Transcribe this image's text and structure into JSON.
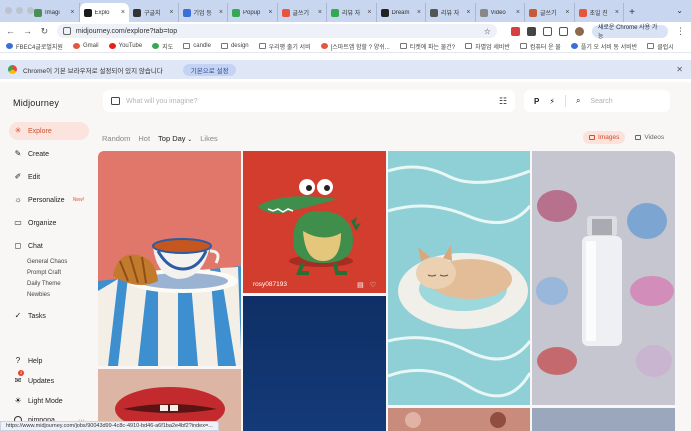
{
  "browser": {
    "tabs": [
      {
        "title": "Imagi",
        "color": "#4a8f5a",
        "active": false
      },
      {
        "title": "Explo",
        "color": "#1b1b1b",
        "active": true
      },
      {
        "title": "구글지",
        "color": "#333333",
        "active": false
      },
      {
        "title": "기업 등",
        "color": "#3a6fd8",
        "active": false
      },
      {
        "title": "Popup",
        "color": "#34a853",
        "active": false
      },
      {
        "title": "글쓰기",
        "color": "#e8553d",
        "active": false
      },
      {
        "title": "리뷰 자",
        "color": "#34a853",
        "active": false
      },
      {
        "title": "Dream",
        "color": "#222222",
        "active": false
      },
      {
        "title": "리뷰 자",
        "color": "#555555",
        "active": false
      },
      {
        "title": "Video",
        "color": "#888888",
        "active": false
      },
      {
        "title": "글쓰기",
        "color": "#c85a3a",
        "active": false
      },
      {
        "title": "초일 진",
        "color": "#e8553d",
        "active": false
      }
    ],
    "url": "midjourney.com/explore?tab=top",
    "profile_label": "새로운 Chrome 사용 가능",
    "bookmarks": [
      {
        "label": "FBEC4글로벌지원",
        "icon_color": "#3a6fd8"
      },
      {
        "label": "Gmail",
        "icon_color": "#e8553d"
      },
      {
        "label": "YouTube",
        "icon_color": "#e62117"
      },
      {
        "label": "지도",
        "icon_color": "#34a853"
      },
      {
        "label": "candle",
        "icon_color": ""
      },
      {
        "label": "design",
        "icon_color": ""
      },
      {
        "label": "우리평 출기 서비",
        "icon_color": ""
      },
      {
        "label": "[스마트앱 함할 ? 양쉬...",
        "icon_color": "#e8553d"
      },
      {
        "label": "티켓에 파는 물건?",
        "icon_color": ""
      },
      {
        "label": "차별업 세비반",
        "icon_color": ""
      },
      {
        "label": "컴퓨터 운 물",
        "icon_color": ""
      },
      {
        "label": "플기 오 서비 동 서비반",
        "icon_color": "#3a6fd8"
      },
      {
        "label": "클럽시",
        "icon_color": ""
      }
    ],
    "infobar_text": "Chrome이 기본 브라우저로 설정되어 있지 않습니다",
    "infobar_button": "기본으로 설정",
    "status_url": "https://www.midjourney.com/jobs/90043d99-4c8c-4910-bd46-a6f1ba2e4bf2?index=..."
  },
  "app": {
    "logo": "Midjourney",
    "nav": [
      {
        "label": "Explore",
        "icon": "compass-icon",
        "glyph": "✳",
        "active": true
      },
      {
        "label": "Create",
        "icon": "brush-icon",
        "glyph": "✎",
        "active": false
      },
      {
        "label": "Edit",
        "icon": "edit-icon",
        "glyph": "✐",
        "active": false
      },
      {
        "label": "Personalize",
        "icon": "personalize-icon",
        "glyph": "☼",
        "active": false,
        "badge": "New!"
      },
      {
        "label": "Organize",
        "icon": "folder-icon",
        "glyph": "▭",
        "active": false
      },
      {
        "label": "Chat",
        "icon": "chat-icon",
        "glyph": "◻",
        "active": false
      }
    ],
    "chat_rooms": [
      "General Chaos",
      "Prompt Craft",
      "Daily Theme",
      "Newbies"
    ],
    "tasks_label": "Tasks",
    "bottom_nav": [
      {
        "label": "Help",
        "icon": "help-icon",
        "glyph": "?"
      },
      {
        "label": "Updates",
        "icon": "updates-icon",
        "glyph": "✉",
        "badge_count": "3"
      },
      {
        "label": "Light Mode",
        "icon": "sun-icon",
        "glyph": "☀"
      }
    ],
    "username": "pimpona",
    "prompt_placeholder": "What will you imagine?",
    "search_placeholder": "Search",
    "filters": [
      "Random",
      "Hot",
      "Top Day",
      "Likes"
    ],
    "active_filter": "Top Day",
    "media_toggle": [
      "Images",
      "Videos"
    ],
    "active_media": "Images",
    "gallery": [
      {
        "id": "tile-tea",
        "caption": ""
      },
      {
        "id": "tile-crocodile",
        "caption": "rosy087193"
      },
      {
        "id": "tile-cat",
        "caption": ""
      },
      {
        "id": "tile-bottle",
        "caption": ""
      },
      {
        "id": "tile-lips",
        "caption": ""
      },
      {
        "id": "tile-navy",
        "caption": ""
      },
      {
        "id": "tile-pool-bottom",
        "caption": ""
      },
      {
        "id": "tile-bottle-bottom",
        "caption": ""
      }
    ]
  }
}
